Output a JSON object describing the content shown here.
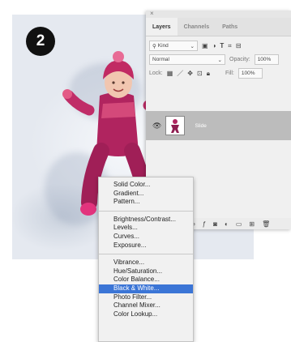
{
  "step_number": "2",
  "panel": {
    "close": "×",
    "tabs": [
      {
        "label": "Layers"
      },
      {
        "label": "Channels"
      },
      {
        "label": "Paths"
      }
    ],
    "filter_kind": "Kind",
    "blend_mode": "Normal",
    "opacity_label": "Opacity:",
    "opacity_value": "100%",
    "lock_label": "Lock:",
    "fill_label": "Fill:",
    "fill_value": "100%",
    "layer_name": "Slide"
  },
  "menu": {
    "group1": [
      "Solid Color...",
      "Gradient...",
      "Pattern..."
    ],
    "group2": [
      "Brightness/Contrast...",
      "Levels...",
      "Curves...",
      "Exposure..."
    ],
    "group3": [
      "Vibrance...",
      "Hue/Saturation...",
      "Color Balance...",
      "Black & White...",
      "Photo Filter...",
      "Channel Mixer...",
      "Color Lookup..."
    ],
    "selected": "Black & White..."
  },
  "colors": {
    "accent": "#3b75d6",
    "badge": "#111111",
    "snowsuit": "#b0245f"
  }
}
